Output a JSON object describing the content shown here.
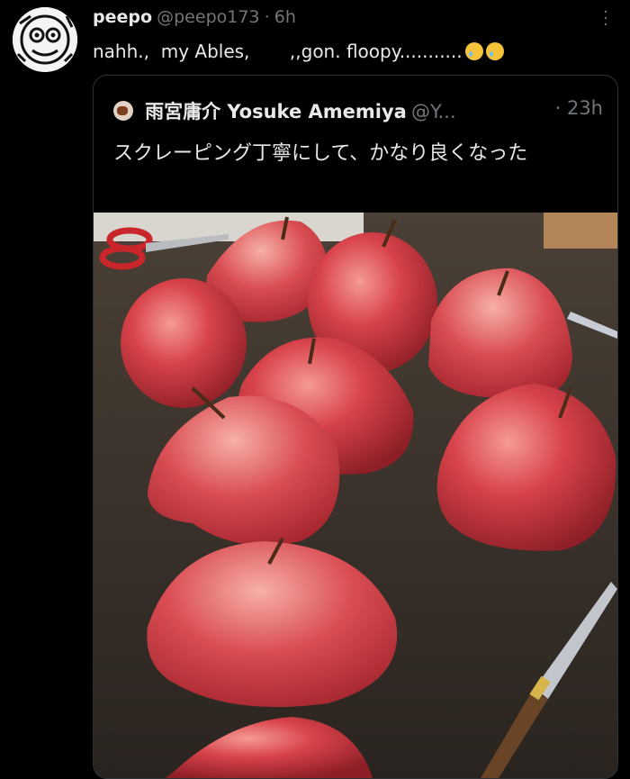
{
  "tweet": {
    "display_name": "peepo",
    "handle": "@peepo173",
    "time": "6h",
    "text_part1": "nahh.,  my Ables,       ,,gon. floopy...........",
    "emojis": [
      "crying-face",
      "crying-face"
    ]
  },
  "quoted": {
    "display_name": "雨宮庸介 Yosuke Amemiya",
    "handle": "@Y...",
    "time": "· 23h",
    "text": "スクレーピング丁寧にして、かなり良くなった",
    "image": {
      "description_icon": "photo",
      "palette": {
        "table": "#3b3128",
        "apple": "#c7303a",
        "apple_highlight": "#f27e78",
        "stem": "#4a2c18"
      }
    }
  }
}
